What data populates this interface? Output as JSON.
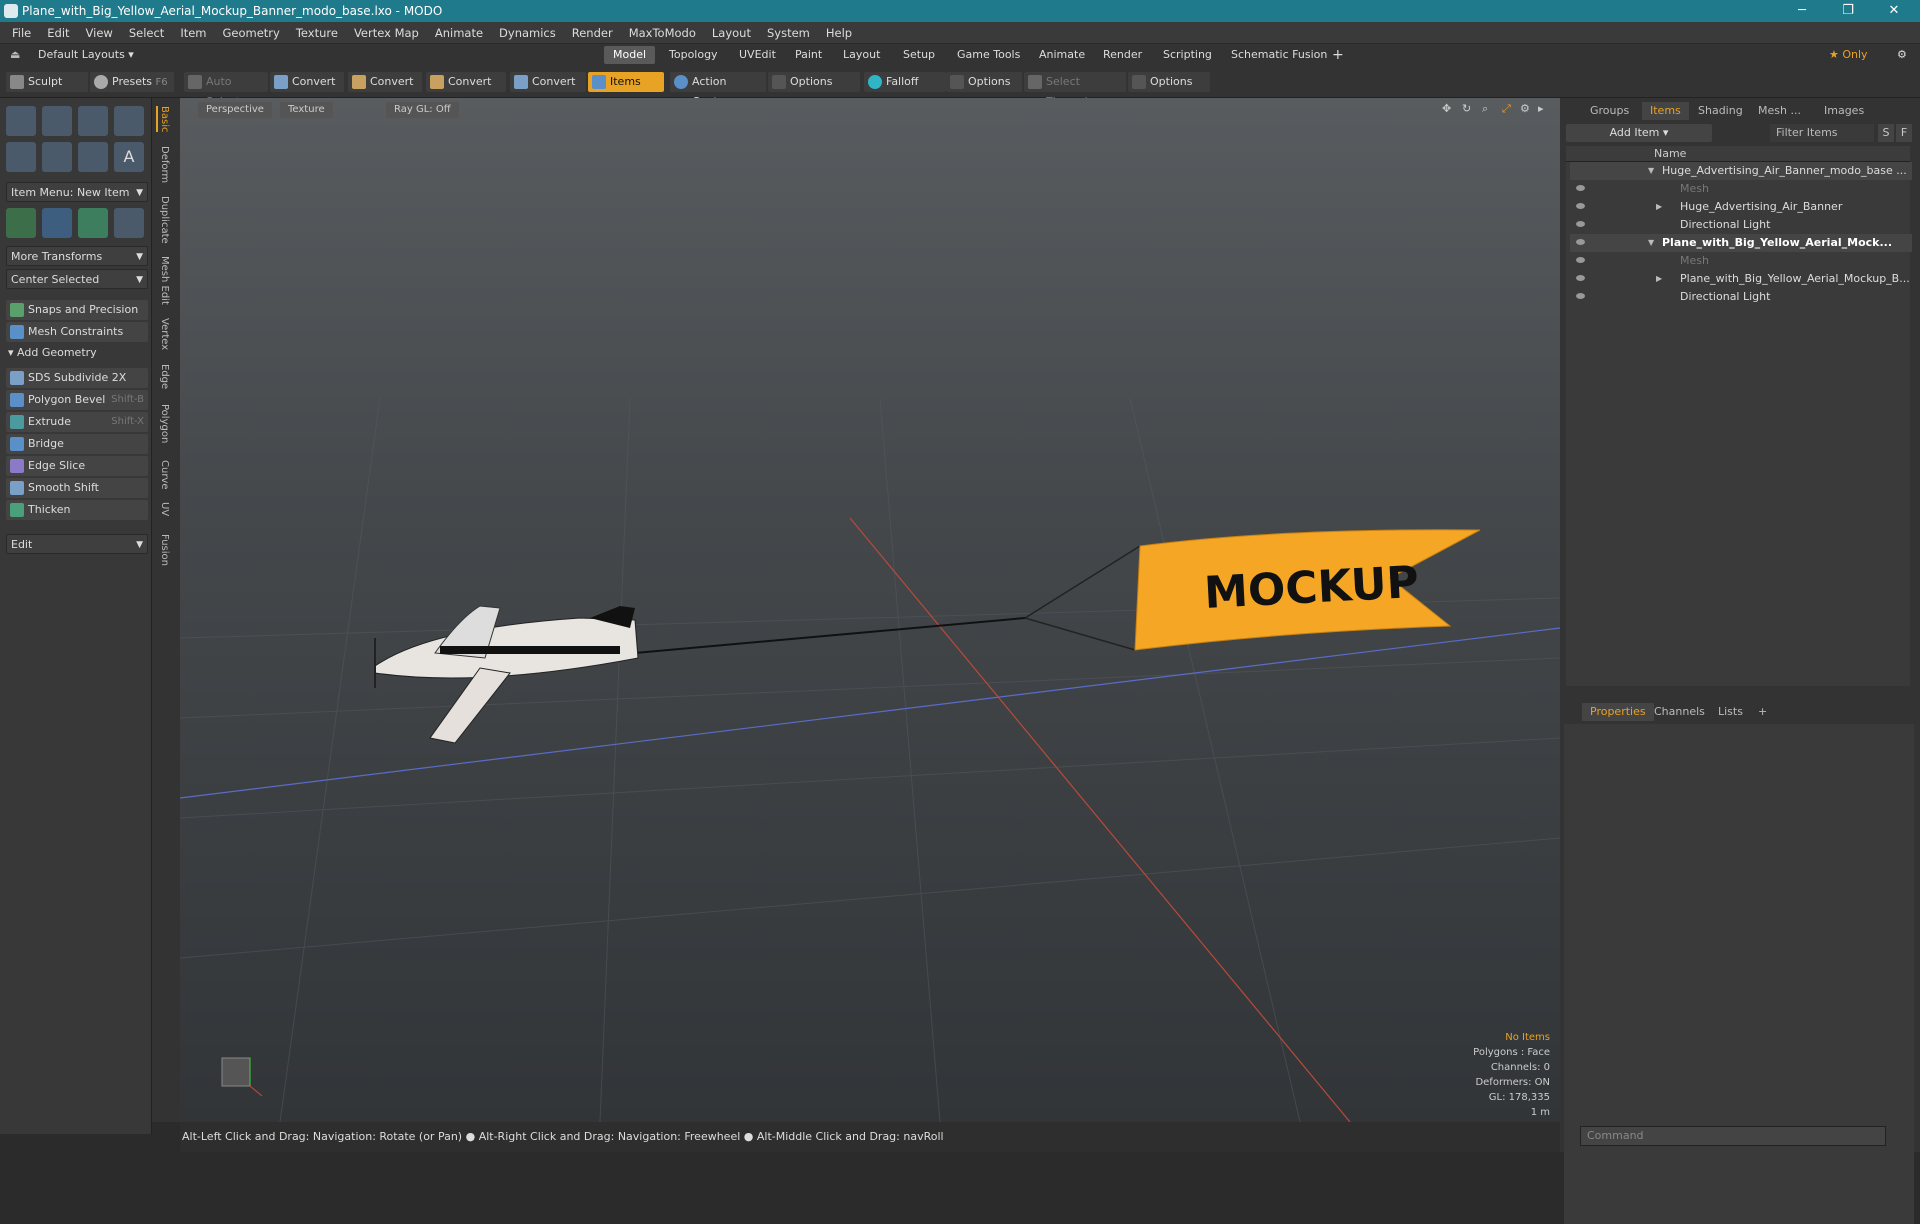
{
  "window": {
    "title": "Plane_with_Big_Yellow_Aerial_Mockup_Banner_modo_base.lxo - MODO",
    "minimize": "─",
    "maximize": "❐",
    "close": "✕"
  },
  "menu": [
    "File",
    "Edit",
    "View",
    "Select",
    "Item",
    "Geometry",
    "Texture",
    "Vertex Map",
    "Animate",
    "Dynamics",
    "Render",
    "MaxToModo",
    "Layout",
    "System",
    "Help"
  ],
  "layout": {
    "default": "Default Layouts ▾",
    "tabs": [
      "Model",
      "Topology",
      "UVEdit",
      "Paint",
      "Layout",
      "Setup",
      "Game Tools",
      "Animate",
      "Render",
      "Scripting",
      "Schematic Fusion"
    ],
    "add": "+",
    "only": "★ Only",
    "gear": "⚙"
  },
  "toolbar": {
    "sculpt": "Sculpt",
    "presets": "Presets",
    "presets_key": "F6",
    "auto_select": "Auto Select",
    "convert": "Convert",
    "items": "Items",
    "action_center": "Action Center",
    "options": "Options",
    "falloff": "Falloff",
    "select_through": "Select Through"
  },
  "left": {
    "item_menu": "Item Menu: New Item",
    "more_transforms": "More Transforms",
    "center_selected": "Center Selected",
    "snaps": "Snaps and Precision",
    "constraints": "Mesh Constraints",
    "add_geometry": "Add Geometry",
    "sds": "SDS Subdivide 2X",
    "bevel": "Polygon Bevel",
    "bevel_key": "Shift-B",
    "extrude": "Extrude",
    "extrude_key": "Shift-X",
    "bridge": "Bridge",
    "edge_slice": "Edge Slice",
    "smooth_shift": "Smooth Shift",
    "thicken": "Thicken",
    "edit": "Edit",
    "vtabs": [
      "Basic",
      "Deform",
      "Duplicate",
      "Mesh Edit",
      "Vertex",
      "Edge",
      "Polygon",
      "Curve",
      "UV",
      "Fusion"
    ]
  },
  "viewport": {
    "perspective": "Perspective",
    "texture": "Texture",
    "raygl": "Ray GL: Off",
    "banner_text": "MOCKUP",
    "stats": {
      "no_items": "No Items",
      "polygons": "Polygons : Face",
      "channels": "Channels: 0",
      "deformers": "Deformers: ON",
      "gl": "GL: 178,335",
      "scale": "1 m"
    }
  },
  "status": "Alt-Left Click and Drag: Navigation: Rotate (or Pan) ● Alt-Right Click and Drag: Navigation: Freewheel ● Alt-Middle Click and Drag: navRoll",
  "right": {
    "tabs": [
      "Groups",
      "Items",
      "Shading",
      "Mesh ...",
      "Images"
    ],
    "add_item": "Add Item",
    "filter": "Filter Items",
    "s": "S",
    "f": "F",
    "name_col": "Name",
    "tree": [
      {
        "label": "Huge_Advertising_Air_Banner_modo_base ...",
        "bold": false
      },
      {
        "label": "Mesh",
        "bold": false,
        "dim": true
      },
      {
        "label": "Huge_Advertising_Air_Banner",
        "bold": false
      },
      {
        "label": "Directional Light",
        "bold": false
      },
      {
        "label": "Plane_with_Big_Yellow_Aerial_Mock...",
        "bold": true
      },
      {
        "label": "Mesh",
        "bold": false,
        "dim": true
      },
      {
        "label": "Plane_with_Big_Yellow_Aerial_Mockup_B...",
        "bold": false
      },
      {
        "label": "Directional Light",
        "bold": false
      }
    ],
    "ptabs": [
      "Properties",
      "Channels",
      "Lists",
      "+"
    ],
    "command": "Command"
  }
}
